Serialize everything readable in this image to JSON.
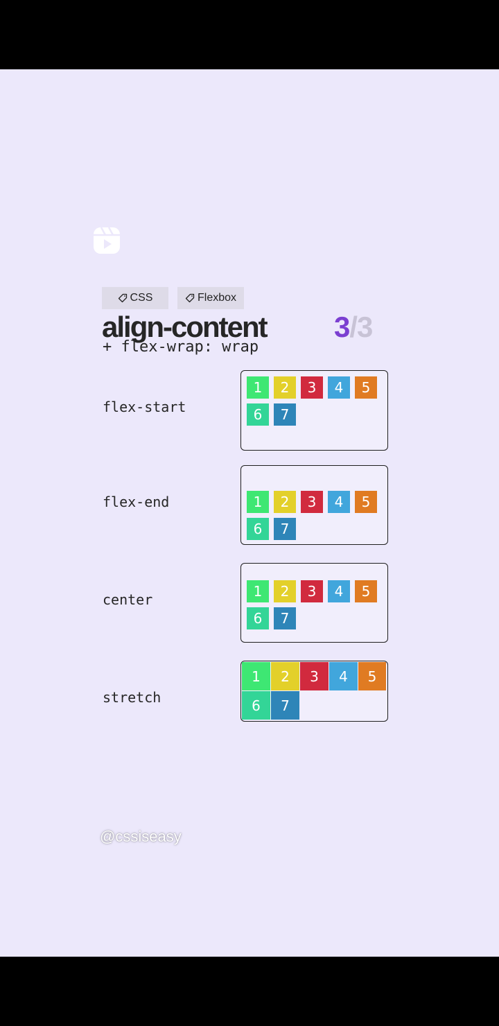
{
  "tags": [
    {
      "label": "CSS",
      "icon": "tag-icon"
    },
    {
      "label": "Flexbox",
      "icon": "tag-icon"
    }
  ],
  "title": "align-content",
  "counter": {
    "current": "3",
    "separator": "/",
    "total": "3"
  },
  "subtitle": "+ flex-wrap: wrap",
  "items": [
    "1",
    "2",
    "3",
    "4",
    "5",
    "6",
    "7"
  ],
  "rows": [
    {
      "label": "flex-start"
    },
    {
      "label": "flex-end"
    },
    {
      "label": "center"
    },
    {
      "label": "stretch"
    }
  ],
  "item_colors": [
    "#3ee773",
    "#e3d02a",
    "#d12a3e",
    "#41a6dc",
    "#e07b22",
    "#33d597",
    "#2e85b8"
  ],
  "accent_color": "#7b3fd1",
  "handle": "@cssiseasy"
}
